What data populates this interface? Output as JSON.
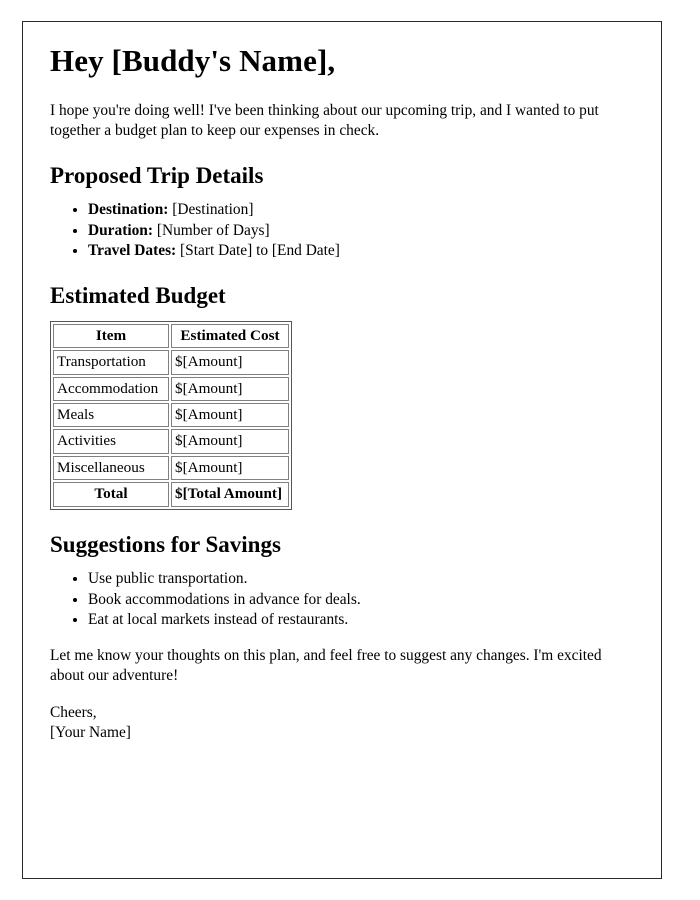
{
  "document": {
    "title": "Hey [Buddy's Name],",
    "intro_paragraph": "I hope you're doing well! I've been thinking about our upcoming trip, and I wanted to put together a budget plan to keep our expenses in check.",
    "sections": {
      "trip_details": {
        "heading": "Proposed Trip Details",
        "items": [
          {
            "label": "Destination:",
            "value": "[Destination]"
          },
          {
            "label": "Duration:",
            "value": "[Number of Days]"
          },
          {
            "label": "Travel Dates:",
            "value": "[Start Date] to [End Date]"
          }
        ]
      },
      "budget": {
        "heading": "Estimated Budget",
        "table": {
          "headers": [
            "Item",
            "Estimated Cost"
          ],
          "rows": [
            {
              "item": "Transportation",
              "cost": "$[Amount]"
            },
            {
              "item": "Accommodation",
              "cost": "$[Amount]"
            },
            {
              "item": "Meals",
              "cost": "$[Amount]"
            },
            {
              "item": "Activities",
              "cost": "$[Amount]"
            },
            {
              "item": "Miscellaneous",
              "cost": "$[Amount]"
            }
          ],
          "total_row": {
            "item": "Total",
            "cost": "$[Total Amount]"
          }
        }
      },
      "savings": {
        "heading": "Suggestions for Savings",
        "items": [
          "Use public transportation.",
          "Book accommodations in advance for deals.",
          "Eat at local markets instead of restaurants."
        ]
      }
    },
    "closing_paragraph": "Let me know your thoughts on this plan, and feel free to suggest any changes. I'm excited about our adventure!",
    "signature": {
      "salutation": "Cheers,",
      "name": "[Your Name]"
    }
  },
  "style": {
    "page_border_color": "#2b2b2b",
    "text_color": "#000000",
    "background": "#ffffff",
    "table_border_color": "#808080"
  }
}
